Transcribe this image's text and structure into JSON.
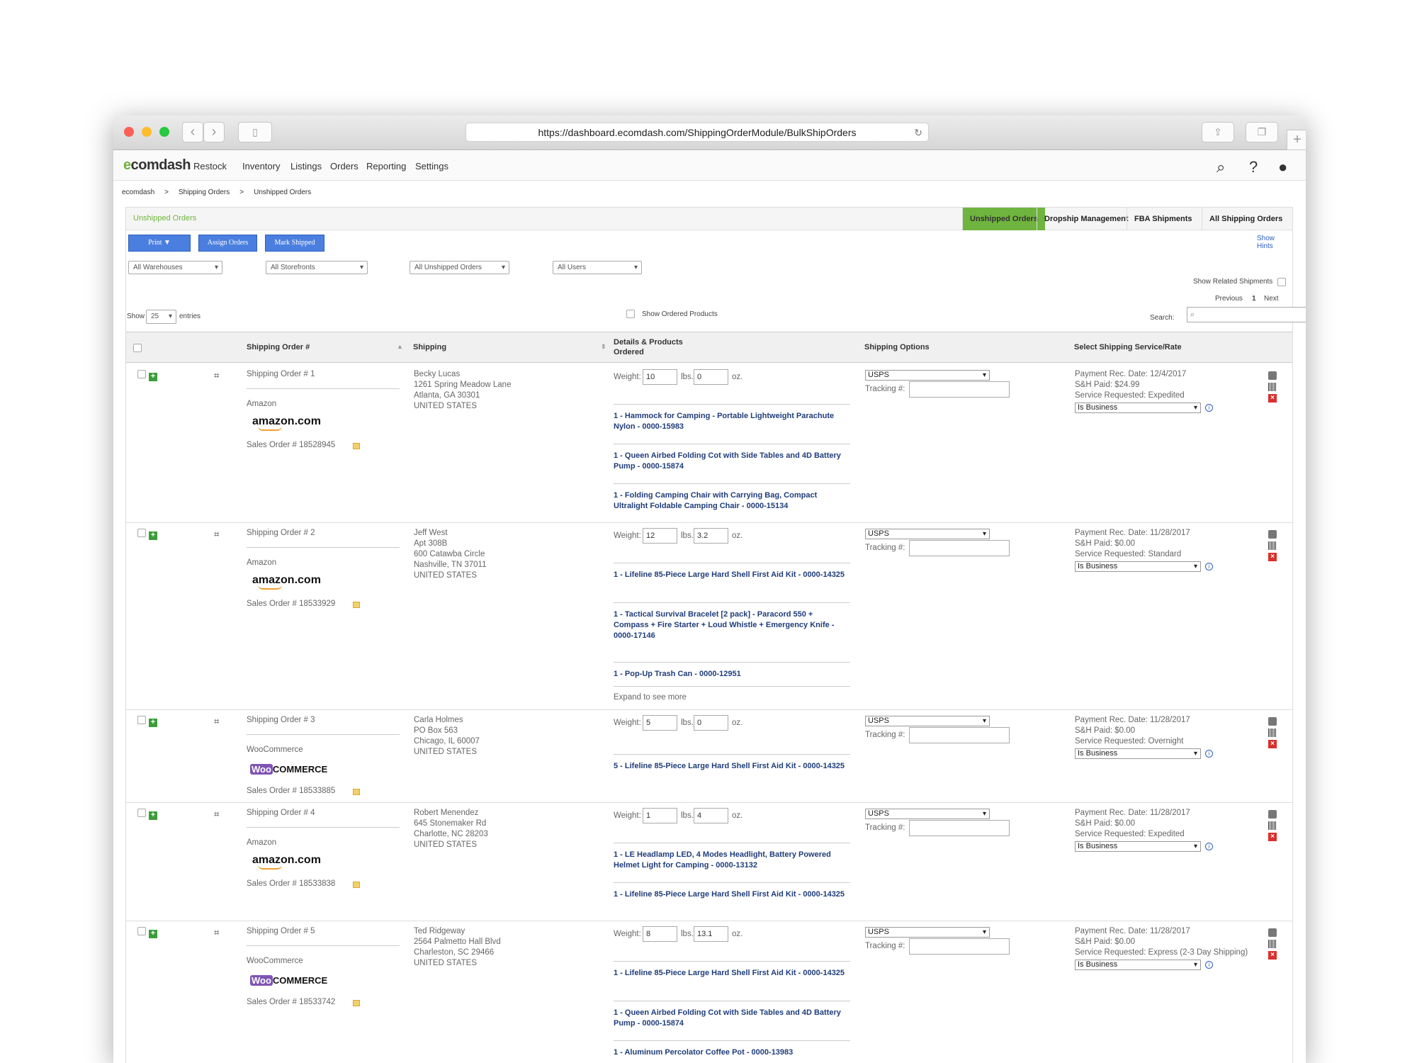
{
  "browser": {
    "url": "https://dashboard.ecomdash.com/ShippingOrderModule/BulkShipOrders"
  },
  "nav": {
    "logo": "ecomdash",
    "items": [
      "Restock",
      "Inventory",
      "Listings",
      "Orders",
      "Reporting",
      "Settings"
    ]
  },
  "breadcrumb": [
    "ecomdash",
    ">",
    "Shipping Orders",
    ">",
    "Unshipped Orders"
  ],
  "panel": {
    "title": "Unshipped Orders",
    "tabs": [
      "Unshipped Orders",
      "Dropship Management",
      "FBA Shipments",
      "All Shipping Orders"
    ],
    "show_hints": "Show Hints"
  },
  "buttons": {
    "print": "Print ▼",
    "assign": "Assign Orders",
    "mark": "Mark Shipped"
  },
  "filters": [
    "All Warehouses",
    "All Storefronts",
    "All Unshipped Orders",
    "All Users"
  ],
  "controls": {
    "show_related": "Show Related Shipments",
    "previous": "Previous",
    "page": "1",
    "next": "Next",
    "show": "Show",
    "entries_value": "25",
    "entries": "entries",
    "show_ordered": "Show Ordered Products",
    "search_label": "Search:"
  },
  "headers": [
    "Shipping Order #",
    "Shipping",
    "Details & Products",
    "Ordered",
    "Shipping Options",
    "Select Shipping Service/Rate"
  ],
  "labels": {
    "weight": "Weight:",
    "lbs": "lbs.",
    "oz": "oz.",
    "tracking": "Tracking #:",
    "carrier": "USPS",
    "business": "Is Business"
  },
  "orders": [
    {
      "so": "Shipping Order # 1",
      "store": "Amazon",
      "logo": "amazon.com",
      "sales": "Sales Order # 18528945",
      "addr": [
        "Becky Lucas",
        "1261 Spring Meadow Lane",
        "Atlanta, GA 30301",
        "UNITED STATES"
      ],
      "lbs": "10",
      "oz": "0",
      "products": [
        "1 - Hammock for Camping - Portable Lightweight Parachute Nylon - 0000-15983",
        "1 - Queen Airbed Folding Cot with Side Tables and 4D Battery Pump - 0000-15874",
        "1 - Folding Camping Chair with Carrying Bag, Compact Ultralight Foldable Camping Chair - 0000-15134"
      ],
      "pay": "Payment Rec. Date: 12/4/2017",
      "sh": "S&H Paid: $24.99",
      "svc": "Service Requested: Expedited"
    },
    {
      "so": "Shipping Order # 2",
      "store": "Amazon",
      "logo": "amazon.com",
      "sales": "Sales Order # 18533929",
      "addr": [
        "Jeff West",
        "Apt 308B",
        "600 Catawba Circle",
        "Nashville, TN 37011",
        "UNITED STATES"
      ],
      "lbs": "12",
      "oz": "3.2",
      "products": [
        "1 - Lifeline 85-Piece Large Hard Shell First Aid Kit - 0000-14325",
        "1 - Tactical Survival Bracelet [2 pack] - Paracord 550 + Compass + Fire Starter + Loud Whistle + Emergency Knife - 0000-17146",
        "1 - Pop-Up Trash Can - 0000-12951"
      ],
      "expand": "Expand to see more",
      "pay": "Payment Rec. Date: 11/28/2017",
      "sh": "S&H Paid: $0.00",
      "svc": "Service Requested: Standard"
    },
    {
      "so": "Shipping Order # 3",
      "store": "WooCommerce",
      "logo": "COMMERCE",
      "logo_w": "Woo",
      "sales": "Sales Order # 18533885",
      "addr": [
        "Carla Holmes",
        "PO Box 563",
        "Chicago, IL 60007",
        "UNITED STATES"
      ],
      "lbs": "5",
      "oz": "0",
      "products": [
        "5 - Lifeline 85-Piece Large Hard Shell First Aid Kit - 0000-14325"
      ],
      "pay": "Payment Rec. Date: 11/28/2017",
      "sh": "S&H Paid: $0.00",
      "svc": "Service Requested: Overnight"
    },
    {
      "so": "Shipping Order # 4",
      "store": "Amazon",
      "logo": "amazon.com",
      "sales": "Sales Order # 18533838",
      "addr": [
        "Robert Menendez",
        "645 Stonemaker Rd",
        "Charlotte, NC 28203",
        "UNITED STATES"
      ],
      "lbs": "1",
      "oz": "4",
      "products": [
        "1 - LE Headlamp LED, 4 Modes Headlight, Battery Powered Helmet Light for Camping - 0000-13132",
        "1 - Lifeline 85-Piece Large Hard Shell First Aid Kit - 0000-14325"
      ],
      "pay": "Payment Rec. Date: 11/28/2017",
      "sh": "S&H Paid: $0.00",
      "svc": "Service Requested: Expedited"
    },
    {
      "so": "Shipping Order # 5",
      "store": "WooCommerce",
      "logo": "COMMERCE",
      "logo_w": "Woo",
      "sales": "Sales Order # 18533742",
      "addr": [
        "Ted Ridgeway",
        "2564 Palmetto Hall Blvd",
        "Charleston, SC 29466",
        "UNITED STATES"
      ],
      "lbs": "8",
      "oz": "13.1",
      "products": [
        "1 - Lifeline 85-Piece Large Hard Shell First Aid Kit - 0000-14325",
        "1 - Queen Airbed Folding Cot with Side Tables and 4D Battery Pump - 0000-15874",
        "1 - Aluminum Percolator Coffee Pot - 0000-13983"
      ],
      "pay": "Payment Rec. Date: 11/28/2017",
      "sh": "S&H Paid: $0.00",
      "svc": "Service Requested: Express (2-3 Day Shipping)"
    }
  ]
}
